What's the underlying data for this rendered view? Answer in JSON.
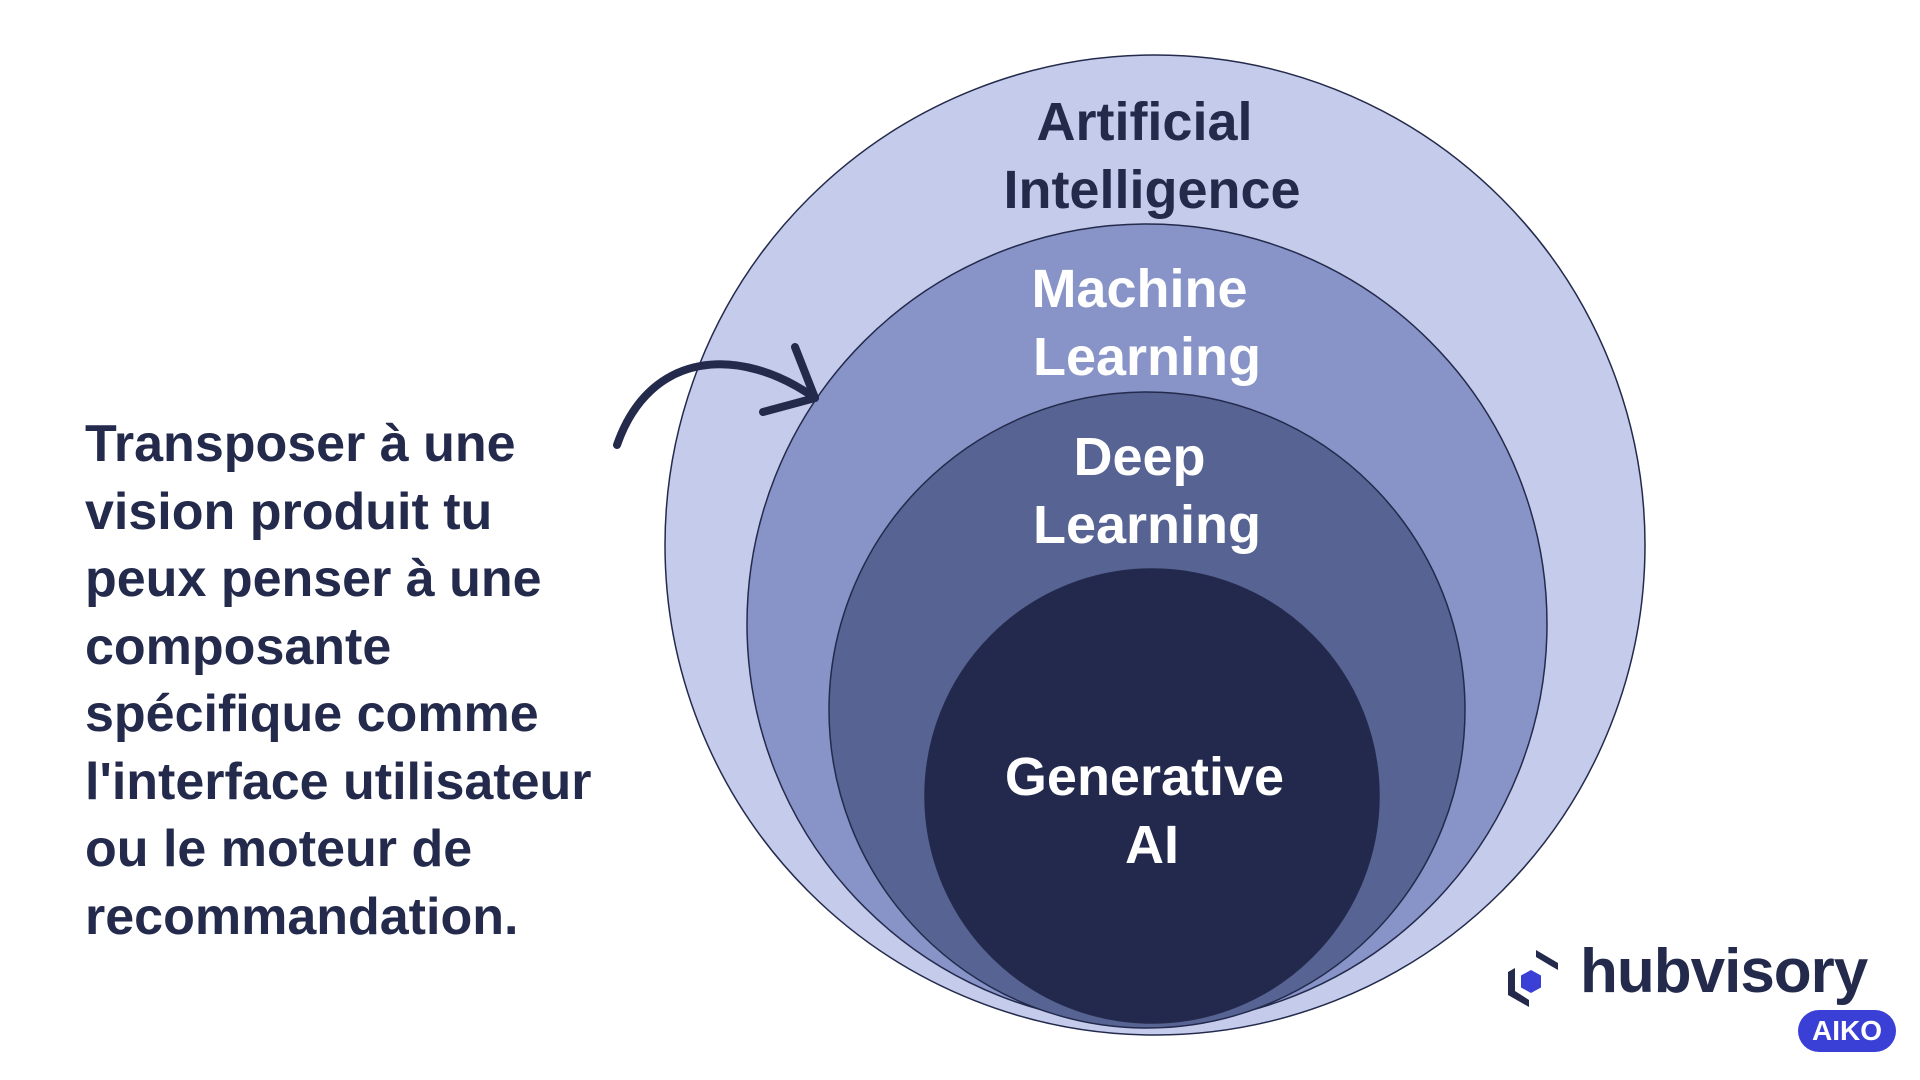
{
  "diagram": {
    "circles": [
      {
        "id": "ai",
        "lines": [
          "Artificial",
          "Intelligence"
        ],
        "fill": "#c5cbea",
        "text_color": "#232a4c"
      },
      {
        "id": "ml",
        "lines": [
          "Machine",
          "Learning"
        ],
        "fill": "#8894c7",
        "text_color": "#ffffff"
      },
      {
        "id": "dl",
        "lines": [
          "Deep",
          "Learning"
        ],
        "fill": "#566393",
        "text_color": "#ffffff"
      },
      {
        "id": "gen",
        "lines": [
          "Generative",
          "AI"
        ],
        "fill": "#23294c",
        "text_color": "#ffffff"
      }
    ],
    "outline_color": "#232a4c"
  },
  "caption": {
    "lines": [
      "Transposer à une",
      "vision produit tu",
      "peux penser à une",
      "composante",
      "spécifique comme",
      "l'interface utilisateur",
      "ou le moteur de",
      "recommandation."
    ],
    "color": "#232a4c"
  },
  "logo": {
    "wordmark": "hubvisory",
    "badge": "AIKO",
    "wordmark_color": "#232a4c",
    "badge_color": "#3a3fd6",
    "mark_color_dark": "#232a4c",
    "mark_color_accent": "#3a3fd6",
    "icon": "hubvisory-hexagon-icon"
  }
}
